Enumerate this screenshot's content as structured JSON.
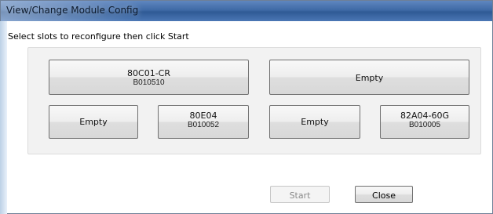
{
  "window": {
    "title": "View/Change Module Config"
  },
  "instruction": "Select slots to reconfigure then click Start",
  "slots": {
    "top_left": {
      "line1": "80C01-CR",
      "line2": "B010510"
    },
    "top_right": {
      "line1": "Empty",
      "line2": ""
    },
    "bottom_1": {
      "line1": "Empty",
      "line2": ""
    },
    "bottom_2": {
      "line1": "80E04",
      "line2": "B010052"
    },
    "bottom_3": {
      "line1": "Empty",
      "line2": ""
    },
    "bottom_4": {
      "line1": "82A04-60G",
      "line2": "B010005"
    }
  },
  "buttons": {
    "start": "Start",
    "close": "Close"
  },
  "colors": {
    "titlebar": "#3f6aa6",
    "panel": "#f2f2f2",
    "disabled_text": "#8a8a8a"
  }
}
